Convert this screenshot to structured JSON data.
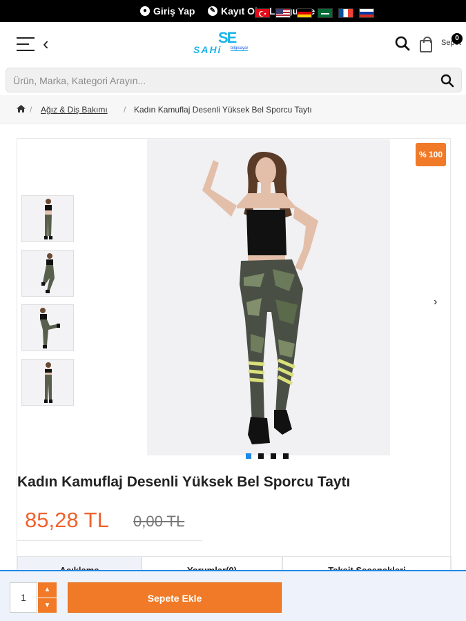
{
  "topbar": {
    "login_label": "Giriş Yap",
    "register_label": "Kayıt Ol",
    "language_label": "Language"
  },
  "header": {
    "logo_mark": "SE",
    "logo_text": "SAHi",
    "logo_sub": "bilgisayar",
    "cart_label": "Sepet",
    "cart_count": "0"
  },
  "search": {
    "placeholder": "Ürün, Marka, Kategori Arayın..."
  },
  "breadcrumb": {
    "category": "Ağız & Diş Bakımı",
    "current": "Kadın Kamuflaj Desenli Yüksek Bel Sporcu Taytı"
  },
  "product": {
    "discount_badge": "% 100",
    "title": "Kadın Kamuflaj Desenli Yüksek Bel Sporcu Taytı",
    "price": "85,28 TL",
    "old_price": "0,00 TL",
    "image_count": 4,
    "active_image": 1
  },
  "tabs": [
    {
      "label": "Açıklama"
    },
    {
      "label": "Yorumlar(0)"
    },
    {
      "label": "Taksit Seçenekleri"
    }
  ],
  "bottom": {
    "quantity": "1",
    "add_to_cart_label": "Sepete Ekle"
  },
  "colors": {
    "accent": "#f07a27",
    "price": "#f0622d",
    "brand": "#1ab4e8"
  }
}
